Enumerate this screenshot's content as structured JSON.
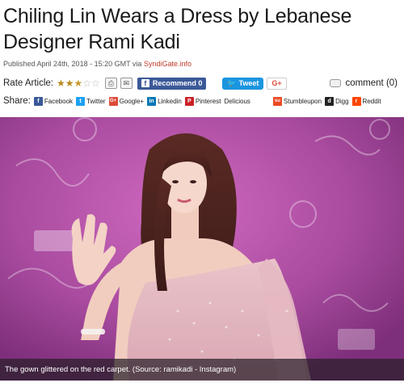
{
  "article": {
    "title": "Chiling Lin Wears a Dress by Lebanese Designer Rami Kadi",
    "published_prefix": "Published April 24th, 2018 - 15:20 GMT via ",
    "source": "SyndiGate.info"
  },
  "rating": {
    "label": "Rate Article:",
    "value": 2.5,
    "max": 5
  },
  "toolbar": {
    "print_icon": "print-icon",
    "email_icon": "email-icon",
    "recommend_label": "Recommend 0",
    "tweet_label": "Tweet",
    "gplus_label": "G+",
    "comment_label": "comment (0)"
  },
  "share": {
    "label": "Share:",
    "items": [
      {
        "label": "Facebook",
        "color": "#3b5998",
        "glyph": "f"
      },
      {
        "label": "Twitter",
        "color": "#1da1f2",
        "glyph": "t"
      },
      {
        "label": "Google+",
        "color": "#dd4b39",
        "glyph": "G+"
      },
      {
        "label": "Linkedin",
        "color": "#0077b5",
        "glyph": "in"
      },
      {
        "label": "Pinterest",
        "color": "#cb2027",
        "glyph": "P"
      },
      {
        "label": "Delicious",
        "color": "",
        "glyph": ""
      },
      {
        "label": "Stumbleupon",
        "color": "#eb4924",
        "glyph": "su"
      },
      {
        "label": "Digg",
        "color": "#222222",
        "glyph": "d"
      },
      {
        "label": "Reddit",
        "color": "#ff4500",
        "glyph": "r"
      }
    ]
  },
  "photo": {
    "caption": "The gown glittered on the red carpet. (Source: ramikadi - Instagram)"
  }
}
